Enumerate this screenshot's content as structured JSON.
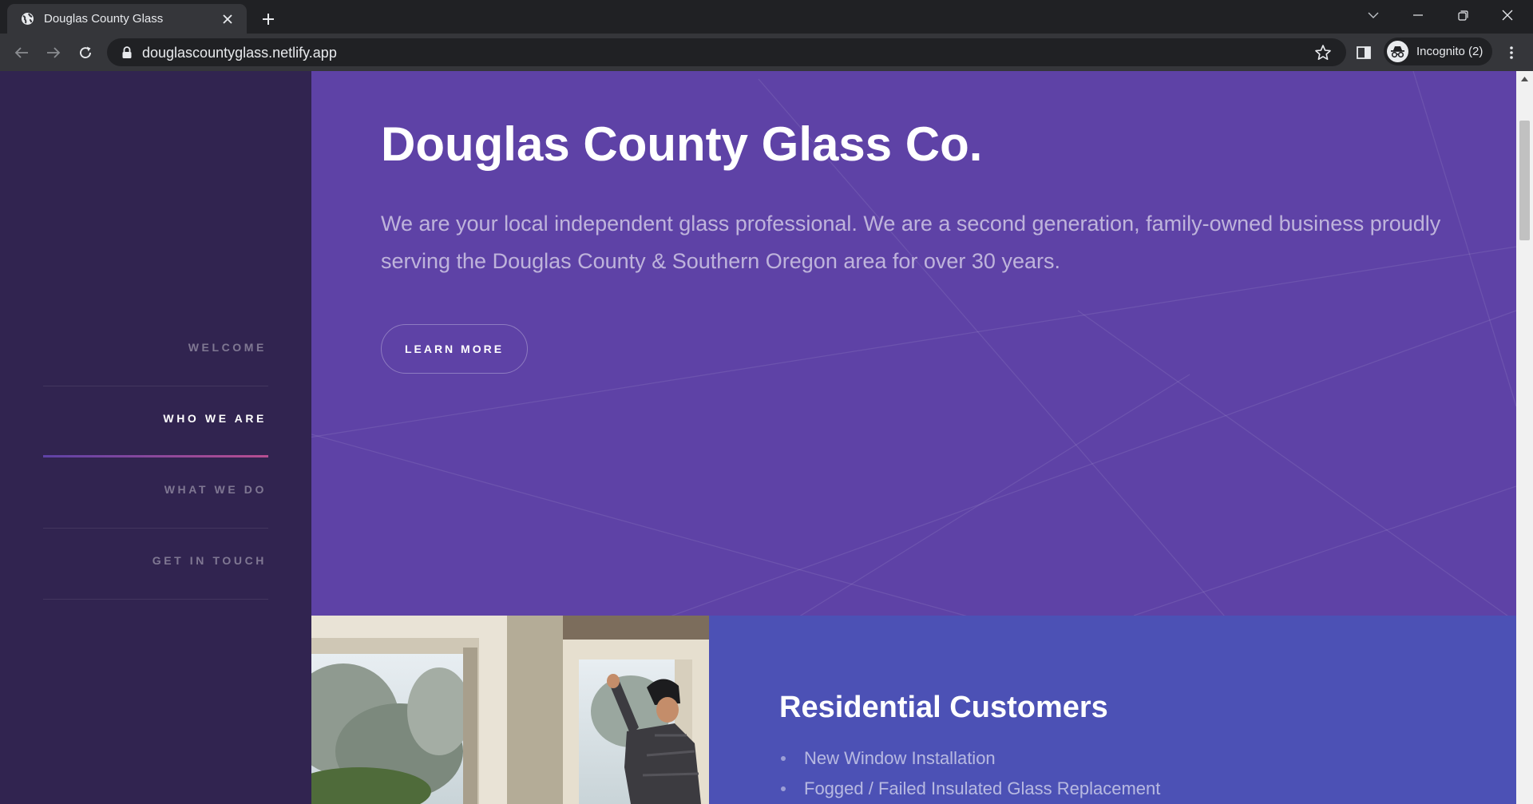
{
  "browser": {
    "tab_title": "Douglas County Glass",
    "url": "douglascountyglass.netlify.app",
    "incognito_label": "Incognito (2)"
  },
  "icons": {
    "favicon": "globe-icon",
    "tab_close": "close-icon",
    "new_tab": "plus-icon",
    "back": "arrow-left-icon",
    "forward": "arrow-right-icon",
    "reload": "reload-icon",
    "secure": "lock-icon",
    "bookmark": "star-icon",
    "side_panel": "side-panel-icon",
    "menu": "kebab-menu-icon"
  },
  "sidebar": {
    "items": [
      {
        "label": "WELCOME",
        "active": false
      },
      {
        "label": "WHO WE ARE",
        "active": true
      },
      {
        "label": "WHAT WE DO",
        "active": false
      },
      {
        "label": "GET IN TOUCH",
        "active": false
      }
    ]
  },
  "hero": {
    "title": "Douglas County Glass Co.",
    "text": "We are your local independent glass professional. We are a second generation, family-owned business proudly serving the Douglas County & Southern Oregon area for over 30 years.",
    "button_label": "LEARN MORE"
  },
  "feature": {
    "title": "Residential Customers",
    "items": [
      "New Window Installation",
      "Fogged / Failed Insulated Glass Replacement"
    ]
  },
  "colors": {
    "sidebar_bg": "#312450",
    "hero_bg": "#5e42a6",
    "feature_bg": "#4c51b5",
    "accent_gradient_start": "#5e42a6",
    "accent_gradient_end": "#b74e91"
  }
}
